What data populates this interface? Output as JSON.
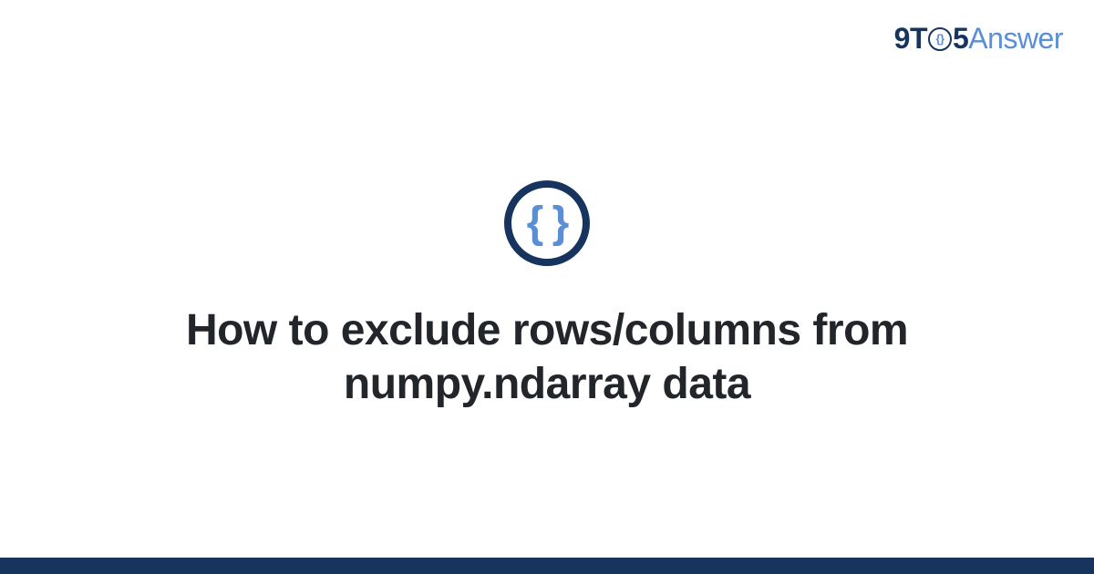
{
  "brand": {
    "prefix": "9T",
    "circle_inner": "{}",
    "mid": "5",
    "suffix": "Answer"
  },
  "icon": {
    "glyph": "{ }"
  },
  "title": "How to exclude rows/columns from numpy.ndarray data",
  "colors": {
    "dark": "#17345f",
    "accent": "#5a8fd6",
    "text": "#222529",
    "bg": "#ffffff"
  }
}
